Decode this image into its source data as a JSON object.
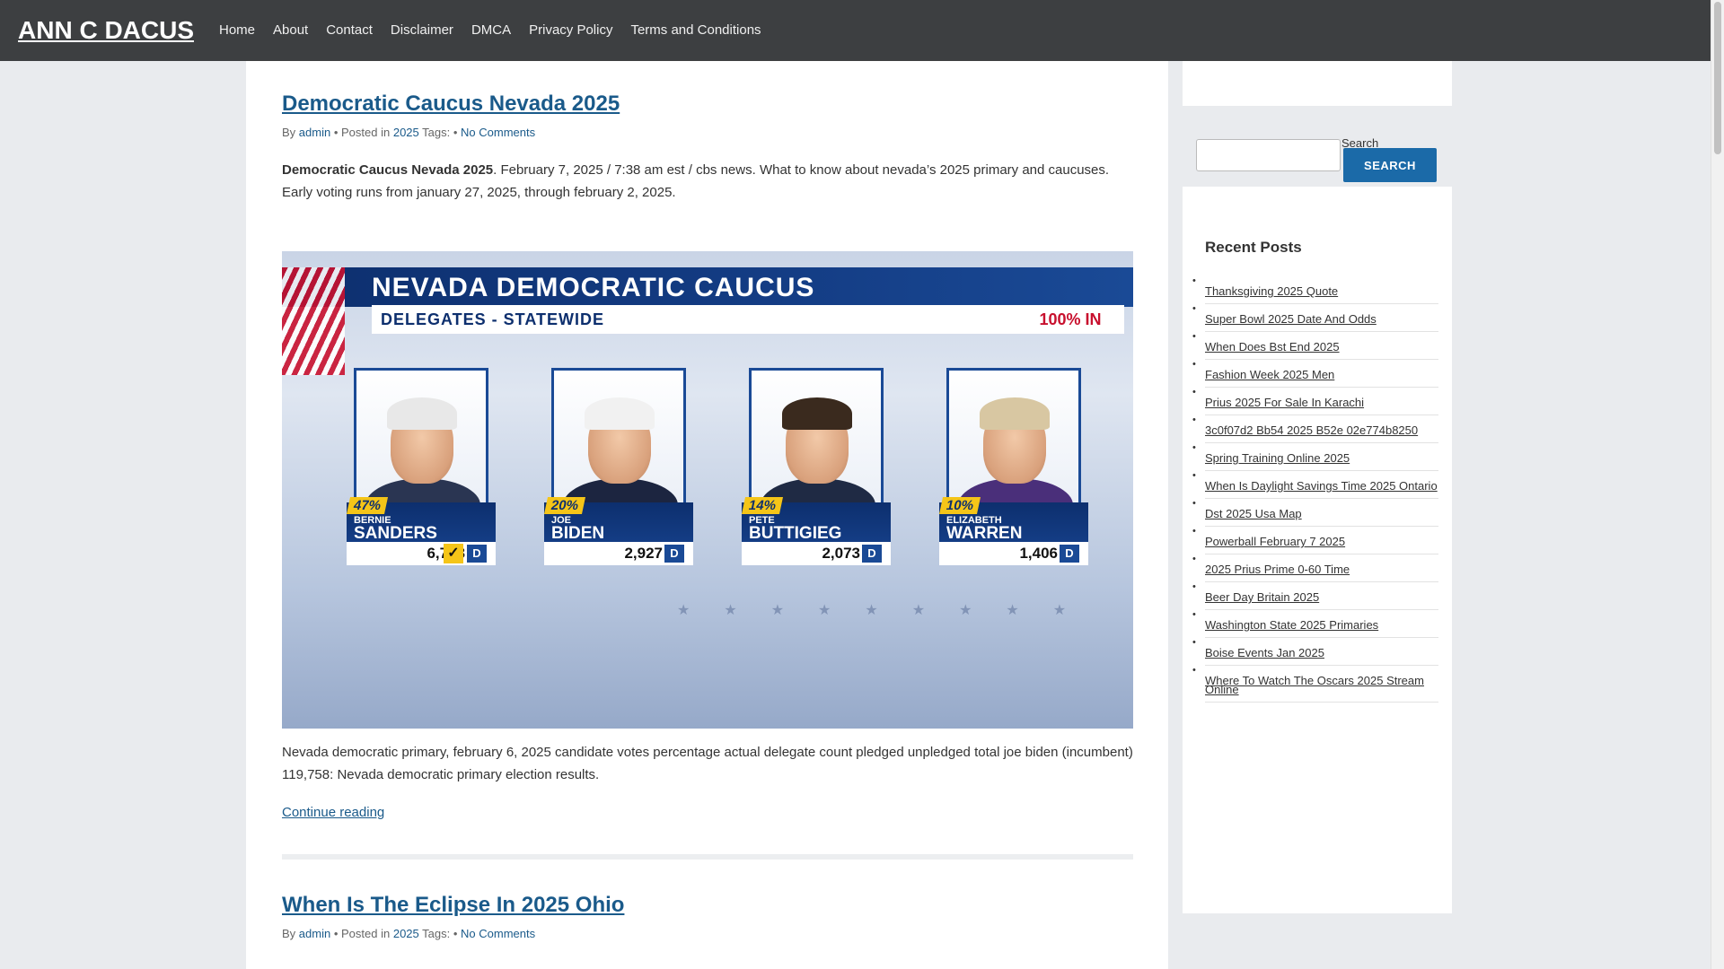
{
  "site": {
    "title": "ANN C DACUS"
  },
  "nav": {
    "items": [
      {
        "label": "Home"
      },
      {
        "label": "About"
      },
      {
        "label": "Contact"
      },
      {
        "label": "Disclaimer"
      },
      {
        "label": "DMCA"
      },
      {
        "label": "Privacy Policy"
      },
      {
        "label": "Terms and Conditions"
      }
    ]
  },
  "posts": [
    {
      "title": "Democratic Caucus Nevada 2025",
      "meta": {
        "by": "By",
        "author": "admin",
        "posted_in": "• Posted in",
        "category": "2025",
        "tags": "Tags:",
        "bullet": "•",
        "comments": "No Comments"
      },
      "intro_bold": "Democratic Caucus Nevada 2025",
      "intro_rest": ". February 7, 2025 / 7:38 am est / cbs news. What to know about nevada’s 2025 primary and caucuses. Early voting runs from january 27, 2025, through february 2, 2025.",
      "image": {
        "banner_title": "NEVADA DEMOCRATIC CAUCUS",
        "banner_sub": "DELEGATES - STATEWIDE",
        "reporting": "100% IN",
        "candidates": [
          {
            "pct": "47%",
            "first": "BERNIE",
            "last": "SANDERS",
            "votes": "6,788",
            "party": "D",
            "winner": true,
            "hair": "#e8e8e8",
            "suit": "#2a3552"
          },
          {
            "pct": "20%",
            "first": "JOE",
            "last": "BIDEN",
            "votes": "2,927",
            "party": "D",
            "winner": false,
            "hair": "#f1f1f1",
            "suit": "#1c2540"
          },
          {
            "pct": "14%",
            "first": "PETE",
            "last": "BUTTIGIEG",
            "votes": "2,073",
            "party": "D",
            "winner": false,
            "hair": "#3a2a1e",
            "suit": "#1f2a44"
          },
          {
            "pct": "10%",
            "first": "ELIZABETH",
            "last": "WARREN",
            "votes": "1,406",
            "party": "D",
            "winner": false,
            "hair": "#d8c7a2",
            "suit": "#4a2f7a"
          }
        ]
      },
      "body": "Nevada democratic primary, february 6, 2025 candidate votes percentage actual delegate count pledged unpledged total joe biden (incumbent) 119,758: Nevada democratic primary election results.",
      "continue": "Continue reading"
    },
    {
      "title": "When Is The Eclipse In 2025 Ohio",
      "meta": {
        "by": "By",
        "author": "admin",
        "posted_in": "• Posted in",
        "category": "2025",
        "tags": "Tags:",
        "bullet": "•",
        "comments": "No Comments"
      }
    }
  ],
  "sidebar": {
    "search": {
      "label": "Search",
      "button": "SEARCH",
      "value": ""
    },
    "recent": {
      "title": "Recent Posts",
      "items": [
        "Thanksgiving 2025 Quote",
        "Super Bowl 2025 Date And Odds",
        "When Does Bst End 2025",
        "Fashion Week 2025 Men",
        "Prius 2025 For Sale In Karachi",
        "3c0f07d2 Bb54 2025 B52e 02e774b8250",
        "Spring Training Online 2025",
        "When Is Daylight Savings Time 2025 Ontario",
        "Dst 2025 Usa Map",
        "Powerball February 7 2025",
        "2025 Prius Prime 0-60 Time",
        "Beer Day Britain 2025",
        "Washington State 2025 Primaries",
        "Boise Events Jan 2025",
        "Where To Watch The Oscars 2025 Stream Online"
      ]
    }
  }
}
